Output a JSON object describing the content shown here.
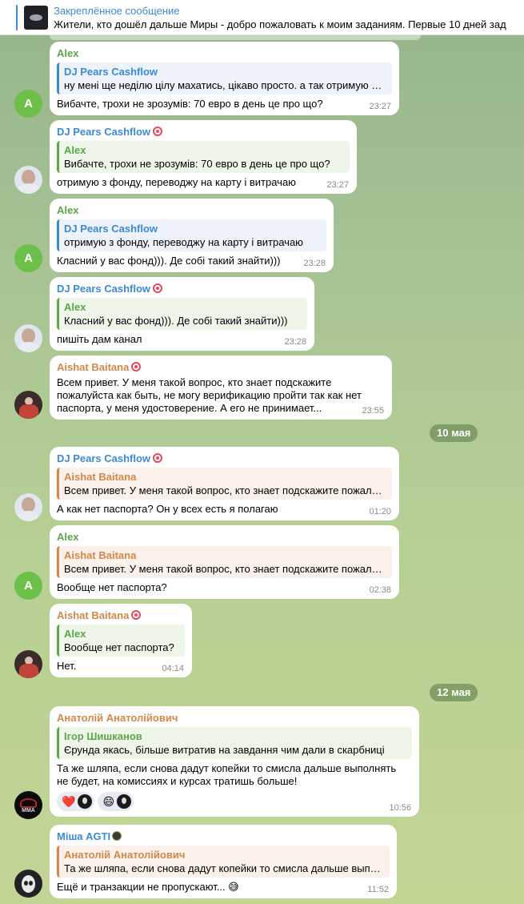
{
  "pinned": {
    "title": "Закреплённое сообщение",
    "text": "Жители, кто дошёл дальше Миры - добро пожаловать к моим заданиям.   Первые 10 дней зад"
  },
  "colors": {
    "alex": "#5ba74a",
    "dj": "#3a8ad6",
    "aishat": "#d2884a",
    "anatoliy": "#d2884a",
    "misha": "#3a8ad6",
    "igor": "#5ba74a"
  },
  "messages": [
    {
      "sender": "Alex",
      "quote_name": "DJ Pears Cashflow",
      "quote_text": "ну мені ще неділю цілу махатись, цікаво просто. а так отримую з фонду, переводжу на карту і витрачаю",
      "text": "Вибачте, трохи не зрозумів: 70 евро в день це про що?",
      "time": "23:27"
    },
    {
      "sender": "DJ Pears Cashflow",
      "quote_name": "Alex",
      "quote_text": "Вибачте, трохи не зрозумів: 70 евро в день це про що?",
      "text": "отримую з фонду, переводжу на карту і витрачаю",
      "time": "23:27"
    },
    {
      "sender": "Alex",
      "quote_name": "DJ Pears Cashflow",
      "quote_text": "отримую з фонду, переводжу на карту і витрачаю",
      "text": "Класний у вас фонд))). Де собі такий знайти)))",
      "time": "23:28"
    },
    {
      "sender": "DJ Pears Cashflow",
      "quote_name": "Alex",
      "quote_text": "Класний у вас фонд))). Де собі такий знайти)))",
      "text": "пишіть дам канал",
      "time": "23:28"
    },
    {
      "sender": "Aishat Baitana",
      "text": "Всем привет.  У меня такой вопрос,  кто знает подскажите\nпожалуйста как быть,  не могу верификацию пройти так как нет\nпаспорта,  у меня удостоверение. А его не принимает...",
      "time": "23:55"
    },
    {
      "sender": "DJ Pears Cashflow",
      "quote_name": "Aishat Baitana",
      "quote_text": "Всем привет.  У меня такой вопрос,  кто знает подскажите пожалуйста как быть",
      "text": "А как нет паспорта? Он у всех есть я полагаю",
      "time": "01:20"
    },
    {
      "sender": "Alex",
      "quote_name": "Aishat Baitana",
      "quote_text": "Всем привет.  У меня такой вопрос,  кто знает подскажите пожалуйста как быть",
      "text": "Вообще нет паспорта?",
      "time": "02:38"
    },
    {
      "sender": "Aishat Baitana",
      "quote_name": "Alex",
      "quote_text": "Вообще нет паспорта?",
      "text": "Нет.",
      "time": "04:14"
    },
    {
      "sender": "Анатолій Анатолійович",
      "quote_name": "Ігор Шишканов",
      "quote_text": "Єрунда якась, більше витратив на завдання чим дали в скарбниці",
      "text": "Та же шляпа, если снова дадут копейки то смисла дальше выполнять\nне будет, на комиссиях и курсах тратишь больше!",
      "time": "10:56",
      "reactions": [
        "❤️",
        "😄"
      ]
    },
    {
      "sender": "Міша AGTI",
      "quote_name": "Анатолій Анатолійович",
      "quote_text": "Та же шляпа, если снова дадут копейки то смисла дальше выполнять",
      "text": "Ещё и транзакции не пропускают... 😅",
      "time": "11:52"
    }
  ],
  "dates": [
    "10 мая",
    "12 мая"
  ],
  "avatars": {
    "alex_letter": "A",
    "mma_text": "MMA"
  }
}
